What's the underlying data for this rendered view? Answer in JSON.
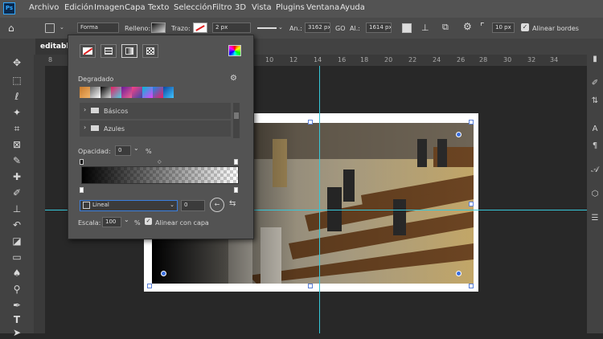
{
  "menu": {
    "logo": "Ps",
    "items": [
      "Archivo",
      "Edición",
      "Imagen",
      "Capa",
      "Texto",
      "Selección",
      "Filtro",
      "3D",
      "Vista",
      "Plugins",
      "Ventana",
      "Ayuda"
    ]
  },
  "options": {
    "mode": "Forma",
    "fill_label": "Relleno:",
    "stroke_label": "Trazo:",
    "stroke_width": "2 px",
    "width_label": "An.:",
    "width_value": "3162 px",
    "link_label": "GO",
    "height_label": "Al.:",
    "height_value": "1614 px",
    "corner_radius": "10 px",
    "align_edges_label": "Alinear bordes"
  },
  "document": {
    "tab_title": "editable"
  },
  "ruler": {
    "numbers": [
      "8",
      "10",
      "12",
      "14",
      "16",
      "18",
      "20",
      "22",
      "24",
      "26",
      "28",
      "30",
      "32",
      "34"
    ]
  },
  "gradient_panel": {
    "section_title": "Degradado",
    "folders": [
      "Básicos",
      "Azules"
    ],
    "opacity_label": "Opacidad:",
    "opacity_value": "0",
    "opacity_unit": "%",
    "type_select": "Lineal",
    "angle_value": "0",
    "scale_label": "Escala:",
    "scale_value": "100",
    "scale_unit": "%",
    "align_layer_label": "Alinear con capa"
  },
  "colors": {
    "guide": "#36c7d9",
    "accent": "#31a8ff",
    "panel_bg": "#535353",
    "workspace": "#282828"
  }
}
